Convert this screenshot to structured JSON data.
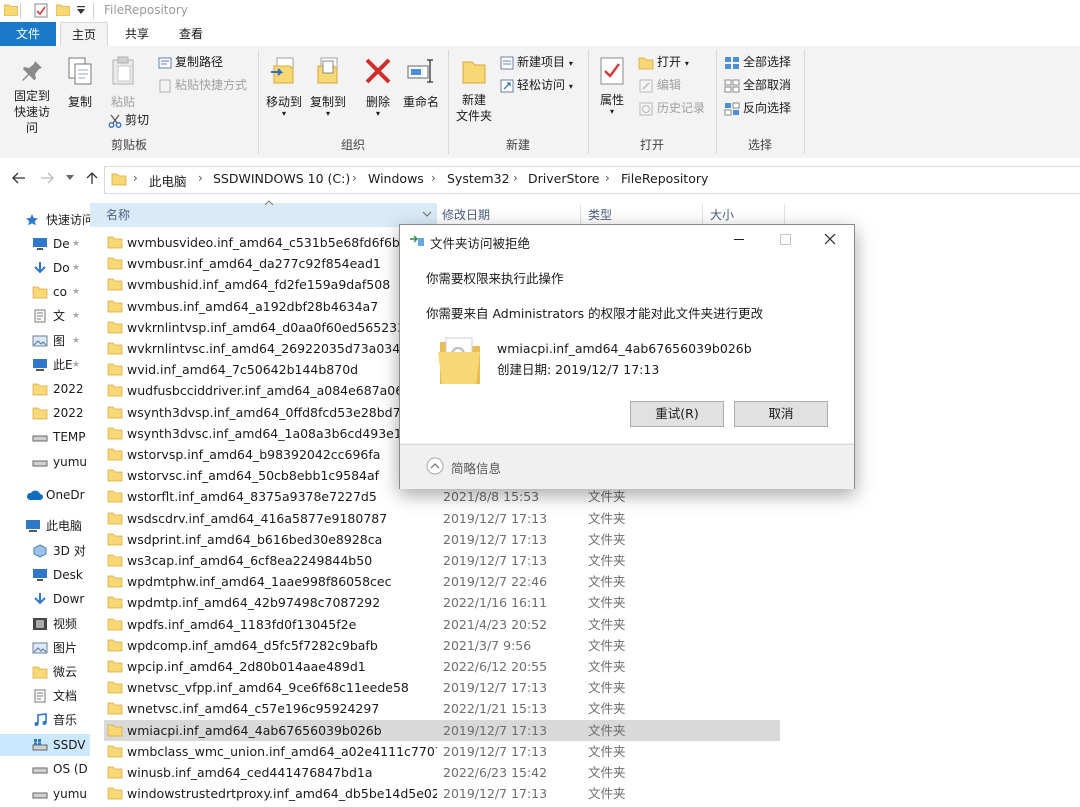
{
  "window": {
    "title": "FileRepository"
  },
  "tabs": {
    "file": "文件",
    "home": "主页",
    "share": "共享",
    "view": "查看"
  },
  "ribbon": {
    "pin_quick_access": "固定到快速访问",
    "copy": "复制",
    "paste": "粘贴",
    "copy_path": "复制路径",
    "paste_shortcut": "粘贴快捷方式",
    "cut": "剪切",
    "clipboard_group": "剪贴板",
    "move_to": "移动到",
    "copy_to": "复制到",
    "delete": "删除",
    "rename": "重命名",
    "organize_group": "组织",
    "new_folder_line1": "新建",
    "new_folder_line2": "文件夹",
    "new_item": "新建项目",
    "easy_access": "轻松访问",
    "new_group": "新建",
    "properties": "属性",
    "open": "打开",
    "edit": "编辑",
    "history": "历史记录",
    "open_group": "打开",
    "select_all": "全部选择",
    "select_none": "全部取消",
    "invert_selection": "反向选择",
    "select_group": "选择"
  },
  "address": {
    "crumbs": [
      "此电脑",
      "SSDWINDOWS 10 (C:)",
      "Windows",
      "System32",
      "DriverStore",
      "FileRepository"
    ]
  },
  "columns": {
    "name": "名称",
    "modified": "修改日期",
    "type": "类型",
    "size": "大小"
  },
  "nav": {
    "items": [
      {
        "label": "快速访问",
        "icon": "star-icon"
      },
      {
        "label": "De",
        "icon": "desktop-icon"
      },
      {
        "label": "Do",
        "icon": "download-icon"
      },
      {
        "label": "co",
        "icon": "folder-icon"
      },
      {
        "label": "文",
        "icon": "document-icon"
      },
      {
        "label": "图",
        "icon": "picture-icon"
      },
      {
        "label": "此E",
        "icon": "computer-icon"
      },
      {
        "label": "2022",
        "icon": "folder-icon"
      },
      {
        "label": "2022",
        "icon": "folder-icon"
      },
      {
        "label": "TEMP",
        "icon": "drive-icon"
      },
      {
        "label": "yumu",
        "icon": "drive-icon"
      },
      {
        "label": "OneDr",
        "icon": "cloud-icon"
      },
      {
        "label": "此电脑",
        "icon": "computer-icon"
      },
      {
        "label": "3D 对",
        "icon": "cube-icon"
      },
      {
        "label": "Desk",
        "icon": "desktop-icon"
      },
      {
        "label": "Dowr",
        "icon": "download-icon"
      },
      {
        "label": "视频",
        "icon": "video-icon"
      },
      {
        "label": "图片",
        "icon": "picture-icon"
      },
      {
        "label": "微云",
        "icon": "folder-icon"
      },
      {
        "label": "文档",
        "icon": "document-icon"
      },
      {
        "label": "音乐",
        "icon": "music-icon"
      },
      {
        "label": "SSDV",
        "icon": "windows-drive-icon"
      },
      {
        "label": "OS (D",
        "icon": "drive-icon"
      },
      {
        "label": "yumu",
        "icon": "drive-icon"
      }
    ]
  },
  "files": [
    {
      "name": "wvmbusvideo.inf_amd64_c531b5e68fd6f6bf",
      "date": "",
      "type": ""
    },
    {
      "name": "wvmbusr.inf_amd64_da277c92f854ead1",
      "date": "",
      "type": ""
    },
    {
      "name": "wvmbushid.inf_amd64_fd2fe159a9daf508",
      "date": "",
      "type": ""
    },
    {
      "name": "wvmbus.inf_amd64_a192dbf28b4634a7",
      "date": "",
      "type": ""
    },
    {
      "name": "wvkrnlintvsp.inf_amd64_d0aa0f60ed565233",
      "date": "",
      "type": ""
    },
    {
      "name": "wvkrnlintvsc.inf_amd64_26922035d73a0342",
      "date": "",
      "type": ""
    },
    {
      "name": "wvid.inf_amd64_7c50642b144b870d",
      "date": "",
      "type": ""
    },
    {
      "name": "wudfusbcciddriver.inf_amd64_a084e687a06b25",
      "date": "",
      "type": ""
    },
    {
      "name": "wsynth3dvsp.inf_amd64_0ffd8fcd53e28bd7",
      "date": "",
      "type": ""
    },
    {
      "name": "wsynth3dvsc.inf_amd64_1a08a3b6cd493e1f",
      "date": "",
      "type": ""
    },
    {
      "name": "wstorvsp.inf_amd64_b98392042cc696fa",
      "date": "",
      "type": ""
    },
    {
      "name": "wstorvsc.inf_amd64_50cb8ebb1c9584af",
      "date": "",
      "type": ""
    },
    {
      "name": "wstorflt.inf_amd64_8375a9378e7227d5",
      "date": "2021/8/8 15:53",
      "type": "文件夹"
    },
    {
      "name": "wsdscdrv.inf_amd64_416a5877e9180787",
      "date": "2019/12/7 17:13",
      "type": "文件夹"
    },
    {
      "name": "wsdprint.inf_amd64_b616bed30e8928ca",
      "date": "2019/12/7 17:13",
      "type": "文件夹"
    },
    {
      "name": "ws3cap.inf_amd64_6cf8ea2249844b50",
      "date": "2019/12/7 17:13",
      "type": "文件夹"
    },
    {
      "name": "wpdmtphw.inf_amd64_1aae998f86058cec",
      "date": "2019/12/7 22:46",
      "type": "文件夹"
    },
    {
      "name": "wpdmtp.inf_amd64_42b97498c7087292",
      "date": "2022/1/16 16:11",
      "type": "文件夹"
    },
    {
      "name": "wpdfs.inf_amd64_1183fd0f13045f2e",
      "date": "2021/4/23 20:52",
      "type": "文件夹"
    },
    {
      "name": "wpdcomp.inf_amd64_d5fc5f7282c9bafb",
      "date": "2021/3/7 9:56",
      "type": "文件夹"
    },
    {
      "name": "wpcip.inf_amd64_2d80b014aae489d1",
      "date": "2022/6/12 20:55",
      "type": "文件夹"
    },
    {
      "name": "wnetvsc_vfpp.inf_amd64_9ce6f68c11eede58",
      "date": "2019/12/7 17:13",
      "type": "文件夹"
    },
    {
      "name": "wnetvsc.inf_amd64_c57e196c95924297",
      "date": "2022/1/21 15:13",
      "type": "文件夹"
    },
    {
      "name": "wmiacpi.inf_amd64_4ab67656039b026b",
      "date": "2019/12/7 17:13",
      "type": "文件夹"
    },
    {
      "name": "wmbclass_wmc_union.inf_amd64_a02e4111c77077...",
      "date": "2019/12/7 17:13",
      "type": "文件夹"
    },
    {
      "name": "winusb.inf_amd64_ced441476847bd1a",
      "date": "2022/6/23 15:42",
      "type": "文件夹"
    },
    {
      "name": "windowstrustedrtproxy.inf_amd64_db5be14d5e02...",
      "date": "2019/12/7 17:13",
      "type": "文件夹"
    }
  ],
  "selected_file_index": 23,
  "dialog": {
    "title": "文件夹访问被拒绝",
    "message1": "你需要权限来执行此操作",
    "message2": "你需要来自 Administrators 的权限才能对此文件夹进行更改",
    "file_name": "wmiacpi.inf_amd64_4ab67656039b026b",
    "created": "创建日期: 2019/12/7 17:13",
    "retry": "重试(R)",
    "cancel": "取消",
    "details": "简略信息"
  },
  "colors": {
    "accent": "#1979ca",
    "folder": "#f8d775",
    "selection": "#d9d9d9",
    "nav_selection": "#cce8ff"
  }
}
